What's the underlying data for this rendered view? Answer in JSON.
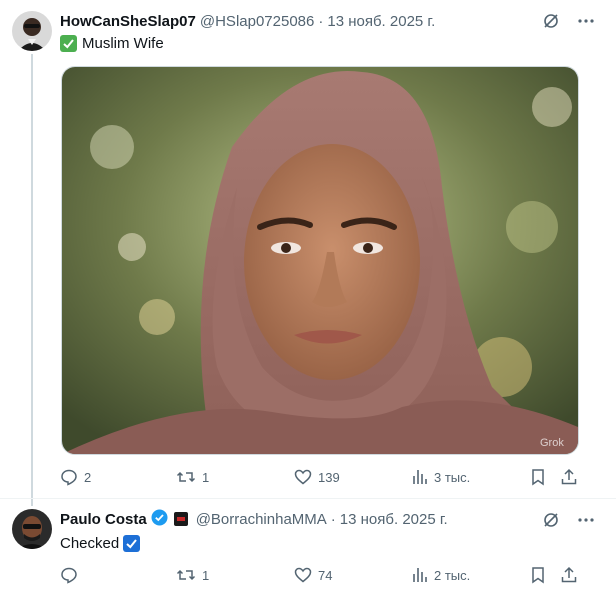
{
  "colors": {
    "accent": "#1d9bf0",
    "muted": "#536471",
    "text": "#0f1419",
    "check_green": "#4caf50"
  },
  "post1": {
    "display_name": "HowCanSheSlap07",
    "handle": "@HSlap0725086",
    "separator": "·",
    "date": "13 нояб. 2025 г.",
    "text": "Muslim Wife",
    "emoji_icon": "green-check-box-icon",
    "image_watermark": "Grok",
    "actions": {
      "replies": "2",
      "reposts": "1",
      "likes": "139",
      "views": "3 тыс."
    }
  },
  "post2": {
    "display_name": "Paulo Costa",
    "handle": "@BorrachinhaMMA",
    "separator": "·",
    "date": "13 нояб. 2025 г.",
    "text": "Checked",
    "emoji_icon": "blue-check-box-icon",
    "verified_icon": "verified-badge-icon",
    "affiliate_icon": "affiliate-badge-icon",
    "actions": {
      "replies": "",
      "reposts": "1",
      "likes": "74",
      "views": "2 тыс."
    }
  }
}
